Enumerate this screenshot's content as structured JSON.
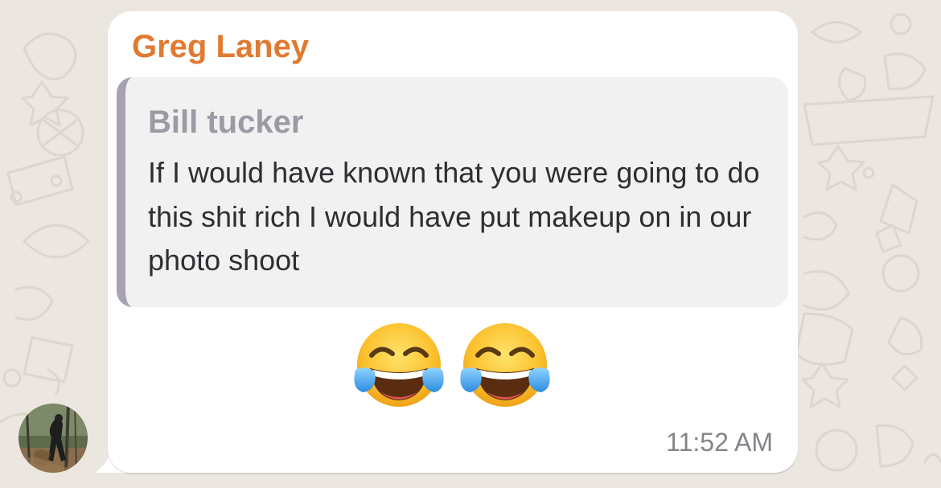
{
  "message": {
    "sender_name": "Greg Laney",
    "sender_color": "#e07a31",
    "reply_to": {
      "author": "Bill tucker",
      "text": "If I would have known that you were going to do this shit rich I would have put makeup on in our photo shoot",
      "accent_color": "#a7a1b2"
    },
    "emojis": [
      "face-with-tears-of-joy",
      "face-with-tears-of-joy"
    ],
    "timestamp": "11:52 AM"
  },
  "avatar": {
    "icon": "avatar-photo"
  },
  "background": {
    "color": "#ebe6df",
    "pattern": "chat-doodle-wallpaper"
  }
}
